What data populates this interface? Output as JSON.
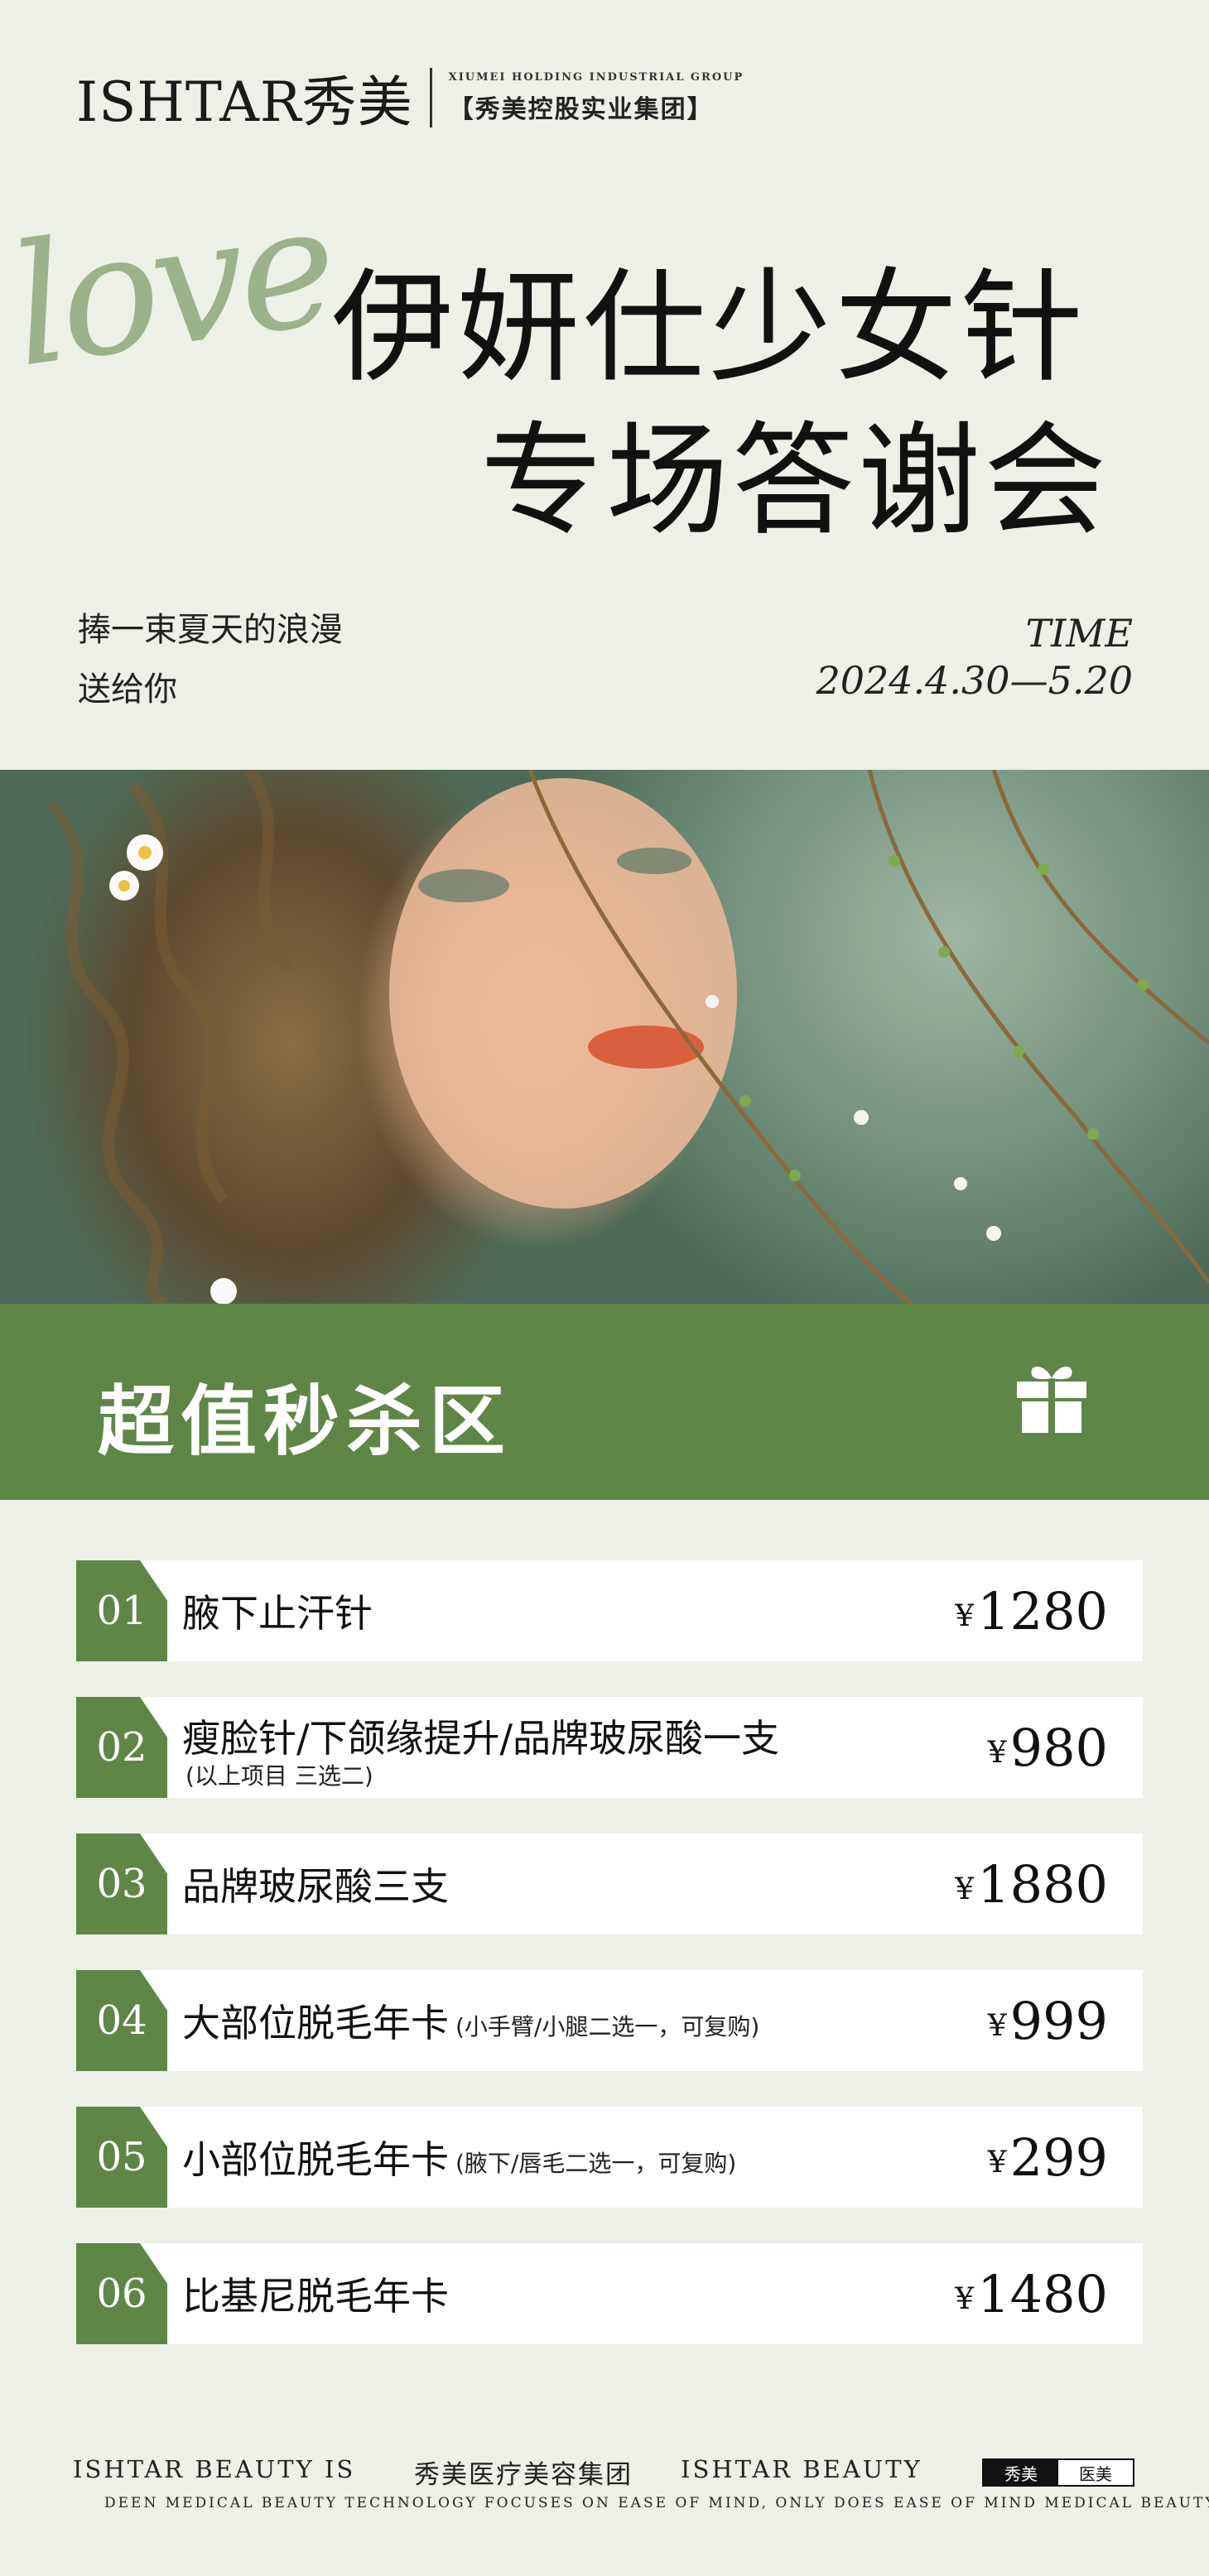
{
  "header": {
    "brand_name": "ISHTAR秀美",
    "group_en": "XIUMEI HOLDING INDUSTRIAL GROUP",
    "group_cn": "【秀美控股实业集团】",
    "script_word": "love",
    "title_line1": "伊妍仕少女针",
    "title_line2": "专场答谢会",
    "tagline_line1": "捧一束夏天的浪漫",
    "tagline_line2": "送给你",
    "time_label": "TIME",
    "time_range": "2024.4.30—5.20"
  },
  "banner": {
    "title": "超值秒杀区",
    "icon": "gift-icon"
  },
  "items": [
    {
      "num": "01",
      "name": "腋下止汗针",
      "note": "",
      "sub": "",
      "currency": "¥",
      "price": "1280"
    },
    {
      "num": "02",
      "name": "瘦脸针/下颌缘提升/品牌玻尿酸一支",
      "note": "",
      "sub": "(以上项目 三选二)",
      "currency": "¥",
      "price": "980"
    },
    {
      "num": "03",
      "name": "品牌玻尿酸三支",
      "note": "",
      "sub": "",
      "currency": "¥",
      "price": "1880"
    },
    {
      "num": "04",
      "name": "大部位脱毛年卡",
      "note": "(小手臂/小腿二选一，可复购)",
      "sub": "",
      "currency": "¥",
      "price": "999"
    },
    {
      "num": "05",
      "name": "小部位脱毛年卡",
      "note": "(腋下/唇毛二选一，可复购)",
      "sub": "",
      "currency": "¥",
      "price": "299"
    },
    {
      "num": "06",
      "name": "比基尼脱毛年卡",
      "note": "",
      "sub": "",
      "currency": "¥",
      "price": "1480"
    }
  ],
  "footer": {
    "en_left": "ISHTAR BEAUTY IS",
    "cn_group": "秀美医疗美容集团",
    "en_right": "ISHTAR BEAUTY",
    "tag_dark": "秀美",
    "tag_light": "医美",
    "tagline": "DEEN MEDICAL BEAUTY TECHNOLOGY FOCUSES ON EASE OF MIND, ONLY DOES EASE OF MIND MEDICAL BEAUTY"
  },
  "colors": {
    "background": "#edf0e6",
    "accent_green": "#5e8646",
    "script_green": "#8ea87a"
  }
}
